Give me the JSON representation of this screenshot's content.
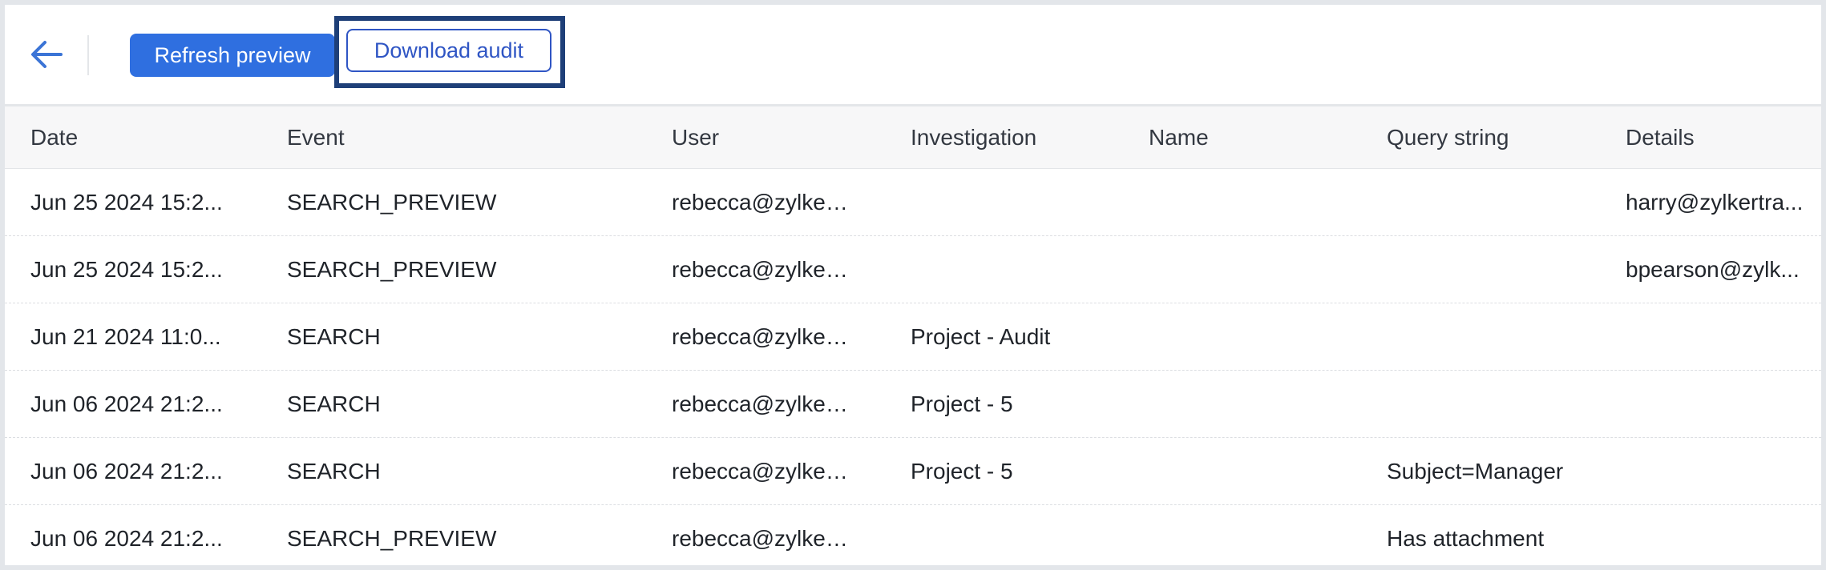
{
  "toolbar": {
    "back_icon": "arrow-left-icon",
    "refresh_label": "Refresh preview",
    "download_label": "Download audit"
  },
  "colors": {
    "primary": "#2f6fe0",
    "outline": "#2f55c4",
    "focus_ring": "#1e3f78",
    "back_icon": "#3b74d6"
  },
  "table": {
    "columns": [
      "Date",
      "Event",
      "User",
      "Investigation",
      "Name",
      "Query string",
      "Details"
    ],
    "rows": [
      [
        "Jun 25 2024 15:2...",
        "SEARCH_PREVIEW",
        "rebecca@zylker...",
        "",
        "",
        "",
        "harry@zylkertra..."
      ],
      [
        "Jun 25 2024 15:2...",
        "SEARCH_PREVIEW",
        "rebecca@zylker...",
        "",
        "",
        "",
        "bpearson@zylk..."
      ],
      [
        "Jun 21 2024 11:0...",
        "SEARCH",
        "rebecca@zylker...",
        "Project - Audit",
        "",
        "",
        ""
      ],
      [
        "Jun 06 2024 21:2...",
        "SEARCH",
        "rebecca@zylker...",
        "Project - 5",
        "",
        "",
        ""
      ],
      [
        "Jun 06 2024 21:2...",
        "SEARCH",
        "rebecca@zylker...",
        "Project - 5",
        "",
        "Subject=Manager",
        ""
      ],
      [
        "Jun 06 2024 21:2...",
        "SEARCH_PREVIEW",
        "rebecca@zylker...",
        "",
        "",
        "Has attachment",
        ""
      ]
    ]
  }
}
